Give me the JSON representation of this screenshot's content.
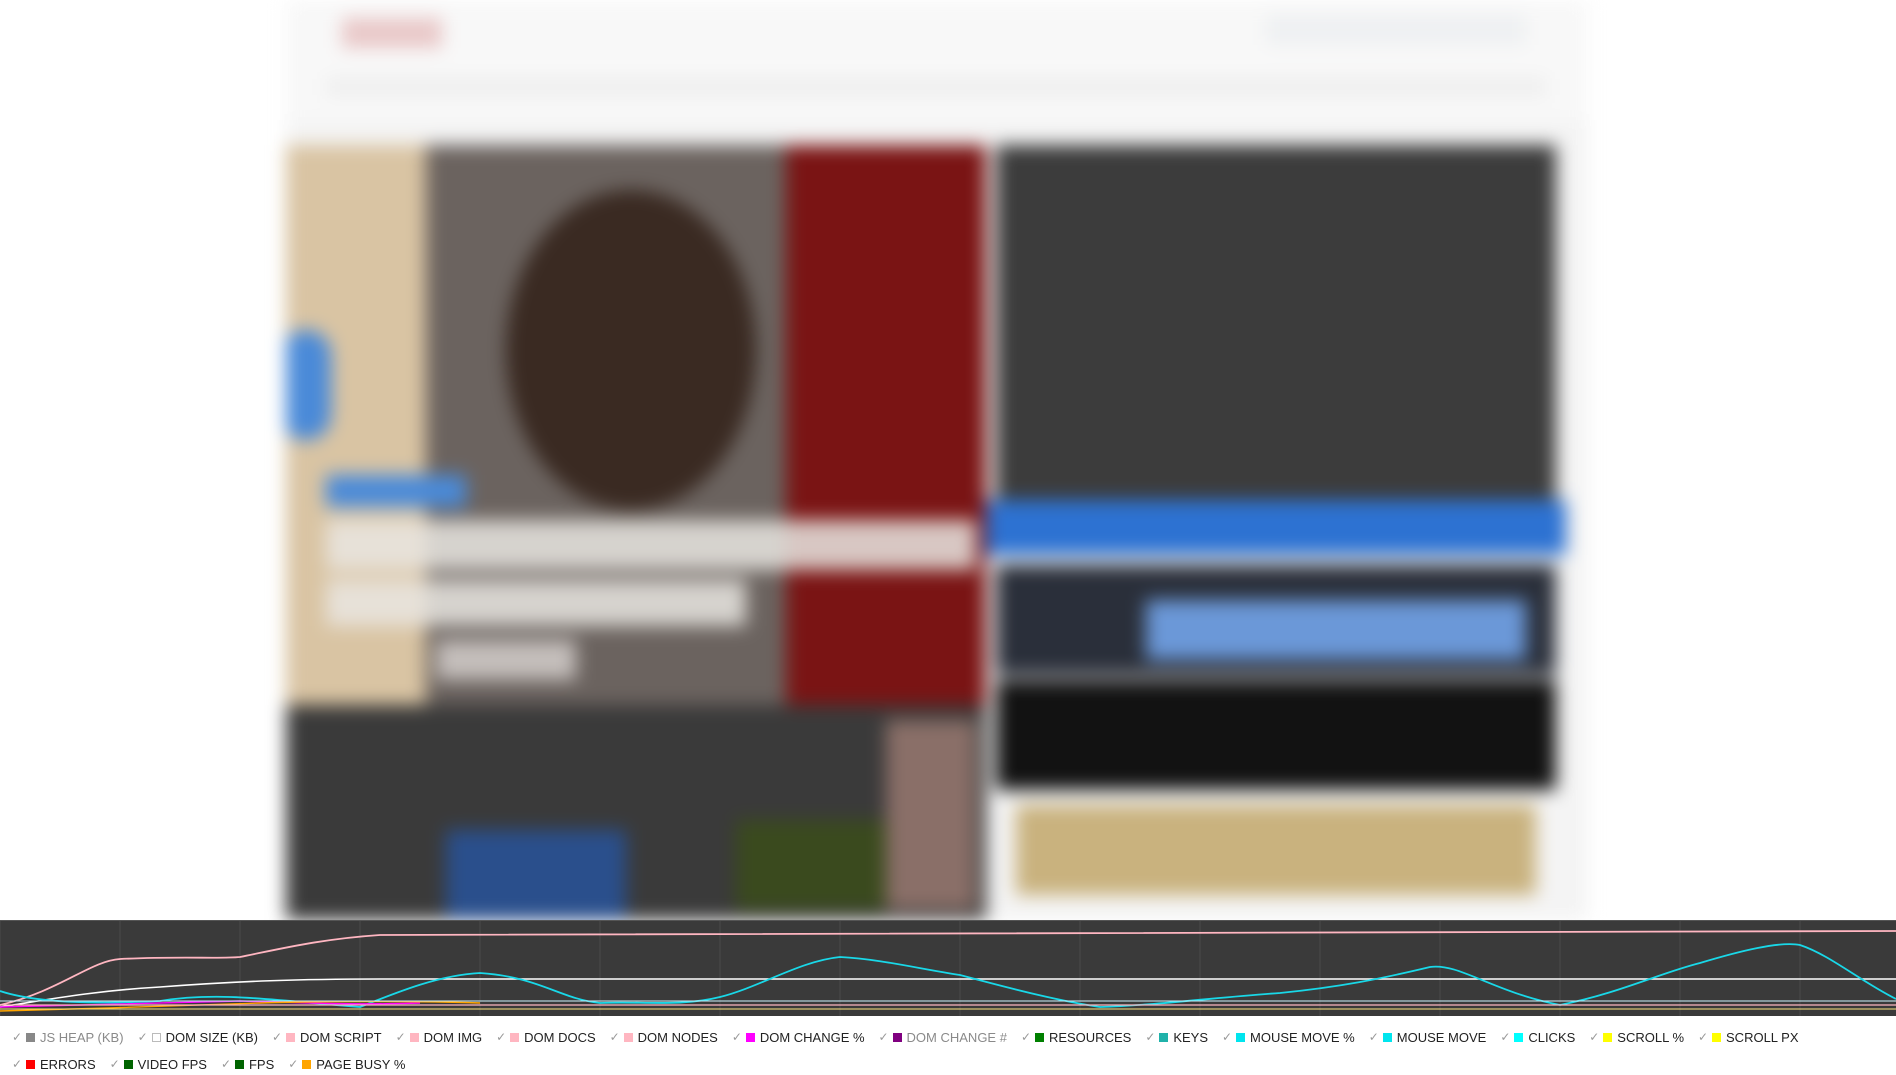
{
  "timeline": {
    "background": "#3a3a3a",
    "gridline_color": "#4a4a4a"
  },
  "legend": {
    "items": [
      {
        "label": "JS HEAP (KB)",
        "color": "#888888",
        "enabled": false
      },
      {
        "label": "DOM SIZE (KB)",
        "color": "#ffffff",
        "enabled": true
      },
      {
        "label": "DOM SCRIPT",
        "color": "#ffb6c1",
        "enabled": true
      },
      {
        "label": "DOM IMG",
        "color": "#ffb6c1",
        "enabled": true
      },
      {
        "label": "DOM DOCS",
        "color": "#ffb6c1",
        "enabled": true
      },
      {
        "label": "DOM NODES",
        "color": "#ffb6c1",
        "enabled": true
      },
      {
        "label": "DOM CHANGE %",
        "color": "#ff00ff",
        "enabled": true
      },
      {
        "label": "DOM CHANGE #",
        "color": "#800080",
        "enabled": false
      },
      {
        "label": "RESOURCES",
        "color": "#008000",
        "enabled": true
      },
      {
        "label": "KEYS",
        "color": "#20b2aa",
        "enabled": true
      },
      {
        "label": "MOUSE MOVE %",
        "color": "#00e5ee",
        "enabled": true
      },
      {
        "label": "MOUSE MOVE",
        "color": "#00e5ee",
        "enabled": true
      },
      {
        "label": "CLICKS",
        "color": "#00ffff",
        "enabled": true
      },
      {
        "label": "SCROLL %",
        "color": "#ffff00",
        "enabled": true
      },
      {
        "label": "SCROLL PX",
        "color": "#ffff00",
        "enabled": true
      },
      {
        "label": "ERRORS",
        "color": "#ff0000",
        "enabled": true
      },
      {
        "label": "VIDEO FPS",
        "color": "#006400",
        "enabled": true
      },
      {
        "label": "FPS",
        "color": "#006400",
        "enabled": true
      },
      {
        "label": "PAGE BUSY %",
        "color": "#ffa500",
        "enabled": true
      }
    ]
  }
}
